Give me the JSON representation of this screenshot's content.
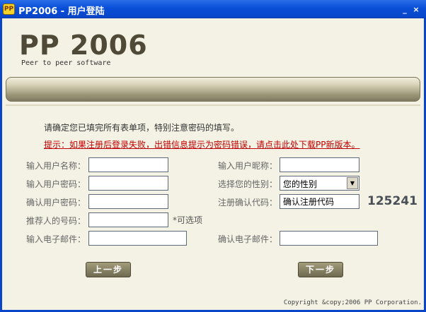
{
  "window": {
    "icon_text": "PP",
    "title": "PP2006 - 用户登陆",
    "minimize": "_",
    "close": "×"
  },
  "header": {
    "logo": "PP 2006",
    "tagline": "Peer to peer software"
  },
  "messages": {
    "instruction": "请确定您已填完所有表单项，特别注意密码的填写。",
    "hint": "提示：如果注册后登录失败，出错信息提示为密码错误，请点击此处下载PP新版本。"
  },
  "form": {
    "username_label": "输入用户名称：",
    "password_label": "输入用户密码：",
    "confirm_password_label": "确认用户密码：",
    "referrer_label": "推荐人的号码：",
    "referrer_optional": "*可选项",
    "email_label": "输入电子邮件：",
    "nickname_label": "输入用户昵称：",
    "gender_label": "选择您的性别：",
    "gender_value": "您的性别",
    "code_label": "注册确认代码：",
    "code_input_value": "确认注册代码",
    "code_number": "125241",
    "confirm_email_label": "确认电子邮件："
  },
  "buttons": {
    "prev": "上一步",
    "next": "下一步"
  },
  "footer": {
    "copyright": "Copyright &copy;2006 PP Corporation."
  }
}
